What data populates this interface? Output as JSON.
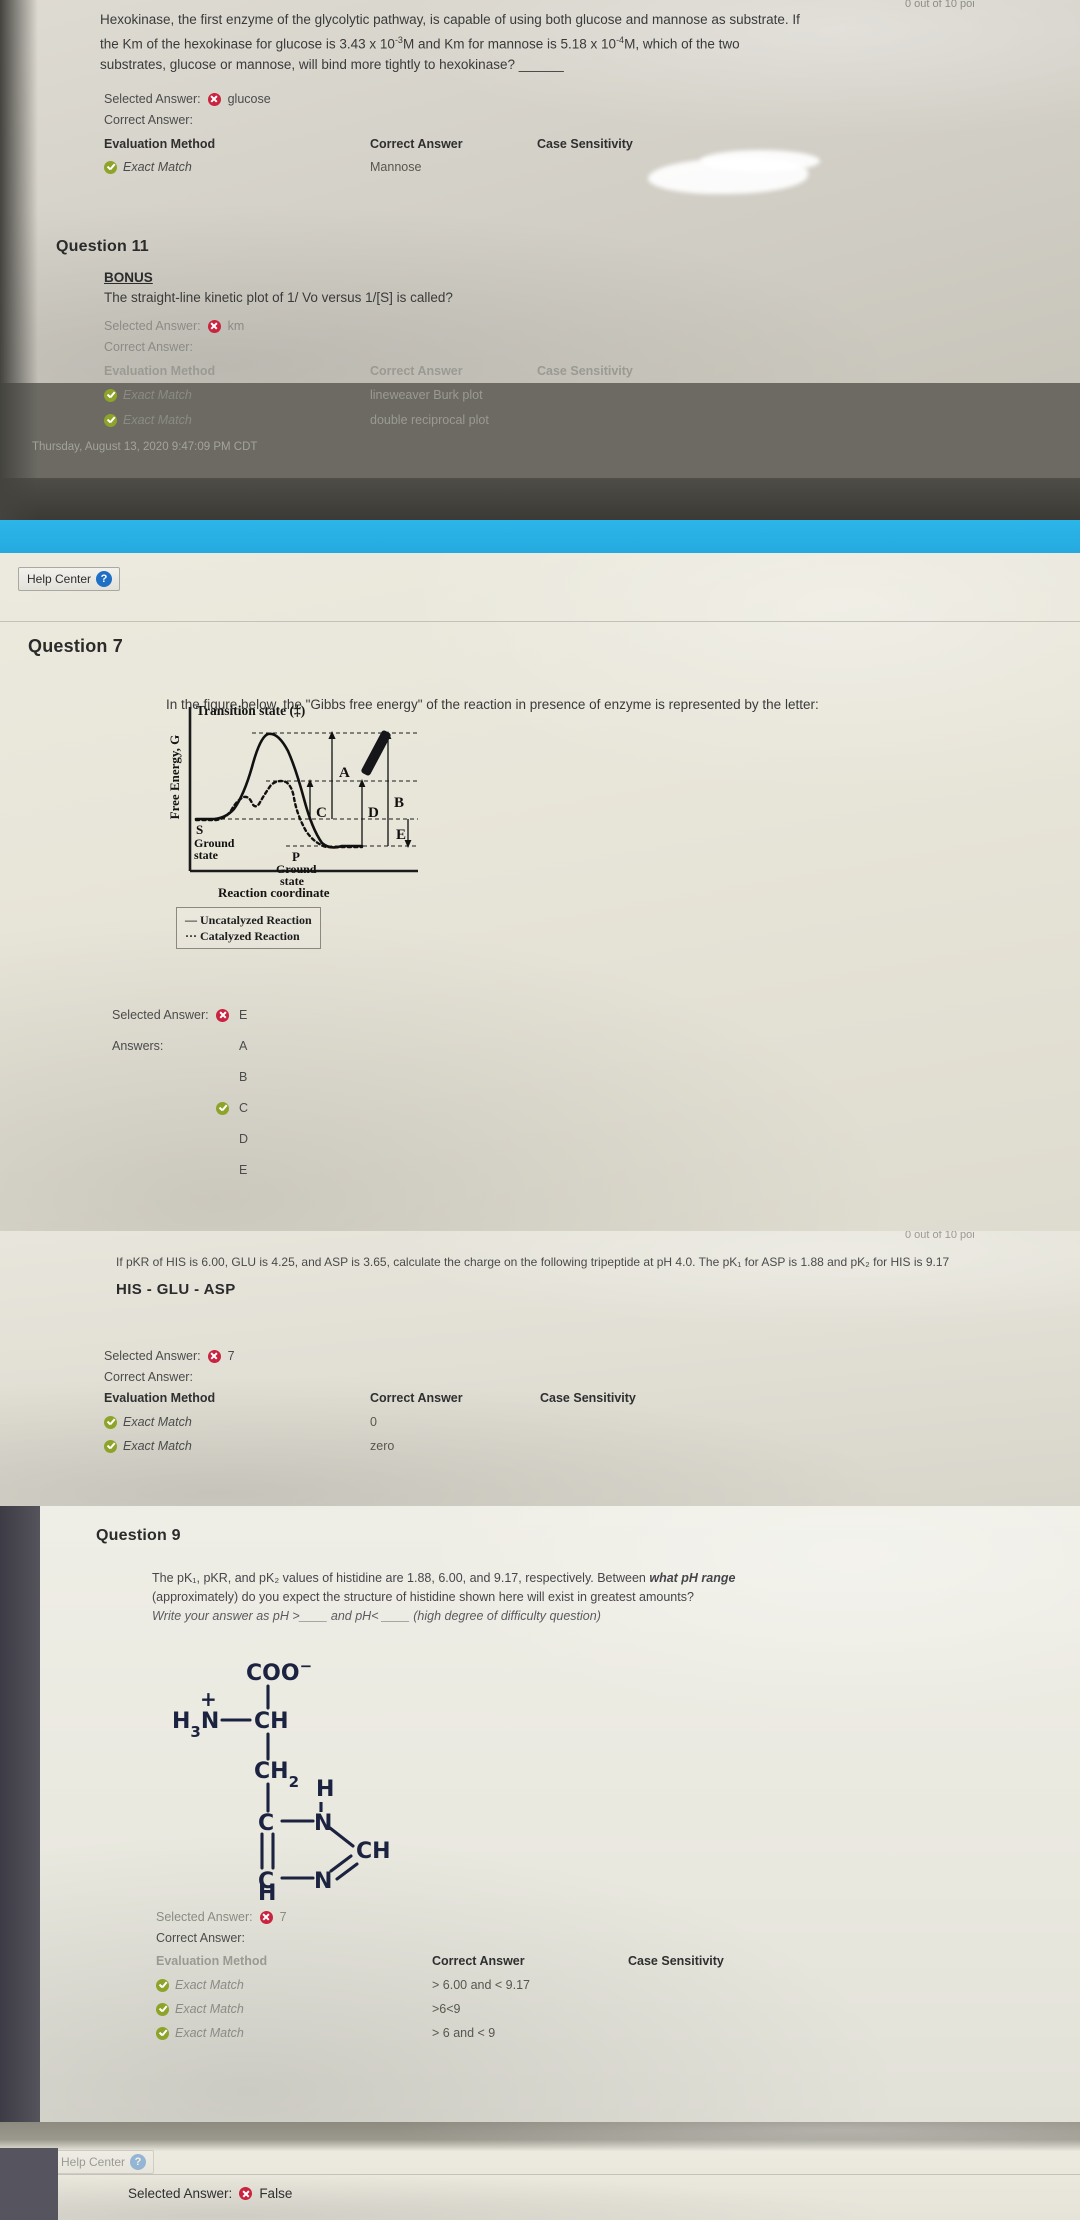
{
  "screen": {
    "top_clipped_text": "0 out of 10 poi"
  },
  "panel1": {
    "question_text": "Hexokinase, the first enzyme of the glycolytic pathway, is capable of using both glucose and mannose as substrate. If the Km of the hexokinase for glucose is 3.43 x 10⁻³M and Km for mannose is 5.18 x 10⁻⁴M, which of the two substrates, glucose or mannose, will bind more tightly to hexokinase? ______",
    "selected_answer_label": "Selected Answer:",
    "selected_answer_value": "glucose",
    "correct_answer_label": "Correct Answer:",
    "table_headers": {
      "evaluation_method": "Evaluation Method",
      "correct_answer": "Correct Answer",
      "case_sensitivity": "Case Sensitivity"
    },
    "rows": [
      {
        "method": "Exact Match",
        "answer": "Mannose",
        "case": ""
      }
    ]
  },
  "panel2": {
    "question_number": "Question 11",
    "bonus_label": "BONUS",
    "question_text": "The straight-line kinetic plot of 1/ Vo versus 1/[S] is called?",
    "selected_answer_label": "Selected Answer:",
    "selected_answer_value": "km",
    "correct_answer_label": "Correct Answer:",
    "table_headers": {
      "evaluation_method": "Evaluation Method",
      "correct_answer": "Correct Answer",
      "case_sensitivity": "Case Sensitivity"
    },
    "rows": [
      {
        "method": "Exact Match",
        "answer": "lineweaver Burk plot"
      },
      {
        "method": "Exact Match",
        "answer": "double reciprocal plot"
      }
    ],
    "timestamp": "Thursday, August 13, 2020 9:47:09 PM CDT"
  },
  "panel3": {
    "help_center_label": "Help Center",
    "help_icon": "question-mark-icon",
    "question_number": "Question 7",
    "question_text": "In the figure below, the \"Gibbs free energy\" of the reaction in presence of enzyme is represented by the letter:",
    "selected_answer_label": "Selected Answer:",
    "selected_answer_value": "E",
    "answers_label": "Answers:",
    "options": [
      {
        "value": "A",
        "state": "none"
      },
      {
        "value": "B",
        "state": "none"
      },
      {
        "value": "C",
        "state": "correct"
      },
      {
        "value": "D",
        "state": "none"
      },
      {
        "value": "E",
        "state": "none"
      }
    ]
  },
  "figure": {
    "title": "Transition state (‡)",
    "ylabel": "Free Energy, G",
    "xlabel": "Reaction coordinate",
    "point_s": "S",
    "point_s_sub": "Ground state",
    "point_p": "P",
    "point_p_sub": "Ground state",
    "markers": [
      "A",
      "B",
      "C",
      "D",
      "E"
    ],
    "legend": [
      {
        "dash": "—",
        "label": "Uncatalyzed Reaction"
      },
      {
        "dash": "···",
        "label": "Catalyzed Reaction"
      }
    ]
  },
  "panel4": {
    "clipped_points": "0 out of 10 poi",
    "question_text": "If pKR of HIS is 6.00, GLU is 4.25, and ASP is 3.65, calculate the charge on the following tripeptide at pH 4.0. The pK₁ for ASP is 1.88 and pK₂ for HIS is 9.17",
    "peptide": "HIS - GLU - ASP",
    "selected_answer_label": "Selected Answer:",
    "selected_answer_value": "7",
    "correct_answer_label": "Correct Answer:",
    "table_headers": {
      "evaluation_method": "Evaluation Method",
      "correct_answer": "Correct Answer",
      "case_sensitivity": "Case Sensitivity"
    },
    "rows": [
      {
        "method": "Exact Match",
        "answer": "0"
      },
      {
        "method": "Exact Match",
        "answer": "zero"
      }
    ]
  },
  "panel5": {
    "question_number": "Question 9",
    "question_text_1": "The pK₁, pKR, and pK₂ values of histidine are 1.88, 6.00, and 9.17, respectively. Between ",
    "question_text_bold": "what pH range",
    "question_text_2": "(approximately) do you expect the structure of histidine shown here will exist in greatest amounts?",
    "question_text_3": "Write your answer as pH >____ and pH< ____ (high degree of difficulty question)",
    "selected_answer_label": "Selected Answer:",
    "selected_answer_value": "7",
    "correct_answer_label": "Correct Answer:",
    "table_headers": {
      "evaluation_method": "Evaluation Method",
      "correct_answer": "Correct Answer",
      "case_sensitivity": "Case Sensitivity"
    },
    "rows": [
      {
        "method": "Exact Match",
        "answer": "> 6.00 and < 9.17"
      },
      {
        "method": "Exact Match",
        "answer": ">6<9"
      },
      {
        "method": "Exact Match",
        "answer": "> 6 and < 9"
      }
    ]
  },
  "chem_structure": {
    "carboxylate": "COO⁻",
    "amino_charge": "+",
    "amino": "H₃N",
    "alpha_carbon": "CH",
    "beta_carbon": "CH₂",
    "ring_c1": "C",
    "ring_n1": "N",
    "ring_nh": "H",
    "ring_ch": "CH",
    "ring_c2": "C",
    "ring_n2": "N",
    "ring_h": "H"
  },
  "panel6": {
    "help_center_label": "Help Center",
    "selected_answer_label": "Selected Answer:",
    "selected_answer_value": "False"
  },
  "colors": {
    "wrong": "#c9233f",
    "correct": "#8ea32a",
    "accent_blue": "#1f6fc4",
    "strip_blue": "#22a6dd"
  }
}
